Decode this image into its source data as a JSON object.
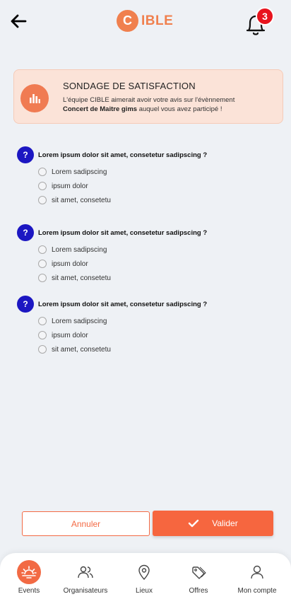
{
  "header": {
    "logo_letter": "C",
    "logo_text": "IBLE",
    "notification_count": "3"
  },
  "survey": {
    "title": "SONDAGE DE SATISFACTION",
    "text_prefix": "L'équipe CIBLE aimerait avoir votre avis sur l'évènnement",
    "event_name": "Concert de Maitre gims",
    "text_suffix": "auquel vous avez participé !"
  },
  "questions": [
    {
      "mark": "?",
      "text": "Lorem ipsum dolor sit amet, consetetur sadipscing   ?",
      "options": [
        "Lorem sadipscing",
        "ipsum dolor",
        "sit amet, consetetu"
      ]
    },
    {
      "mark": "?",
      "text": "Lorem ipsum dolor sit amet, consetetur sadipscing   ?",
      "options": [
        "Lorem sadipscing",
        "ipsum dolor",
        "sit amet, consetetu"
      ]
    },
    {
      "mark": "?",
      "text": "Lorem ipsum dolor sit amet, consetetur sadipscing   ?",
      "options": [
        "Lorem sadipscing",
        "ipsum dolor",
        "sit amet, consetetu"
      ]
    }
  ],
  "actions": {
    "cancel_label": "Annuler",
    "validate_label": "Valider"
  },
  "nav": {
    "items": [
      {
        "label": "Events",
        "icon": "sunrise-icon",
        "active": true
      },
      {
        "label": "Organisateurs",
        "icon": "users-icon",
        "active": false
      },
      {
        "label": "Lieux",
        "icon": "map-pin-icon",
        "active": false
      },
      {
        "label": "Offres",
        "icon": "tags-icon",
        "active": false
      },
      {
        "label": "Mon compte",
        "icon": "user-icon",
        "active": false
      }
    ]
  },
  "colors": {
    "brand": "#f0804e",
    "accent": "#f6663f",
    "question_mark": "#1c17c2",
    "badge": "#e8141e",
    "survey_bg": "#fbe3d8",
    "page_bg": "#eef1f5"
  }
}
